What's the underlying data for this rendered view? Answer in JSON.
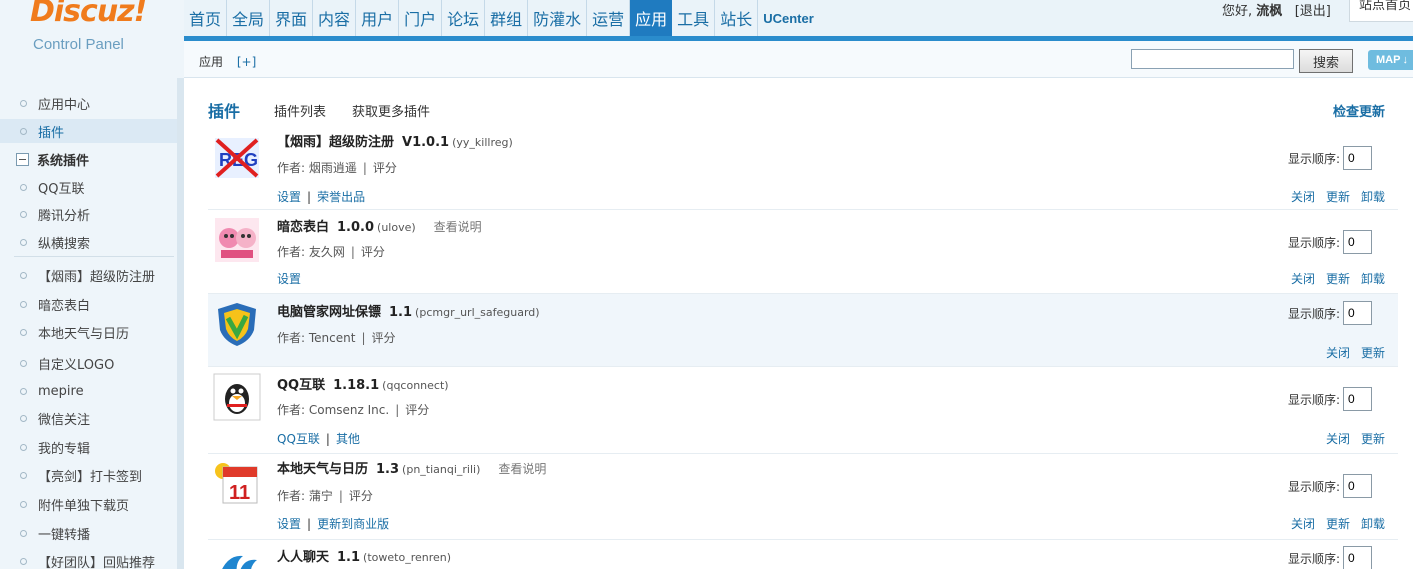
{
  "logo": {
    "main": "Discuz!",
    "sub": "Control Panel"
  },
  "topnav": [
    {
      "label": "首页"
    },
    {
      "label": "全局"
    },
    {
      "label": "界面"
    },
    {
      "label": "内容"
    },
    {
      "label": "用户"
    },
    {
      "label": "门户"
    },
    {
      "label": "论坛"
    },
    {
      "label": "群组"
    },
    {
      "label": "防灌水"
    },
    {
      "label": "运营"
    },
    {
      "label": "应用"
    },
    {
      "label": "工具"
    },
    {
      "label": "站长"
    },
    {
      "label": "UCenter"
    }
  ],
  "user": {
    "greeting": "您好,",
    "name": "流枫",
    "logout": "[退出]",
    "site_home": "站点首页"
  },
  "subbar": {
    "crumb": "应用",
    "plus": "[+]",
    "search_value": "",
    "search_button": "搜索",
    "map_label": "MAP"
  },
  "sidebar": {
    "items": [
      {
        "label": "应用中心"
      },
      {
        "label": "插件"
      },
      {
        "label": "系统插件"
      },
      {
        "label": "QQ互联"
      },
      {
        "label": "腾讯分析"
      },
      {
        "label": "纵横搜索"
      },
      {
        "label": "【烟雨】超级防注册"
      },
      {
        "label": "暗恋表白"
      },
      {
        "label": "本地天气与日历"
      },
      {
        "label": "自定义LOGO"
      },
      {
        "label": "mepire"
      },
      {
        "label": "微信关注"
      },
      {
        "label": "我的专辑"
      },
      {
        "label": "【亮剑】打卡签到"
      },
      {
        "label": "附件单独下载页"
      },
      {
        "label": "一键转播"
      },
      {
        "label": "【好团队】回贴推荐"
      }
    ]
  },
  "main": {
    "title": "插件",
    "tab_list": "插件列表",
    "tab_more": "获取更多插件",
    "check_update": "检查更新",
    "order_label": "显示顺序:",
    "plugins": [
      {
        "name": "【烟雨】超级防注册",
        "version": "V1.0.1",
        "ident": "(yy_killreg)",
        "readme": "",
        "author": "作者: 烟雨逍遥",
        "rate": "评分",
        "links": [
          "设置",
          "荣誉出品"
        ],
        "actions": [
          "关闭",
          "更新",
          "卸载"
        ],
        "order": "0"
      },
      {
        "name": "暗恋表白",
        "version": "1.0.0",
        "ident": "(ulove)",
        "readme": "查看说明",
        "author": "作者: 友久网",
        "rate": "评分",
        "links": [
          "设置"
        ],
        "actions": [
          "关闭",
          "更新",
          "卸载"
        ],
        "order": "0"
      },
      {
        "name": "电脑管家网址保镖",
        "version": "1.1",
        "ident": "(pcmgr_url_safeguard)",
        "readme": "",
        "author": "作者: Tencent",
        "rate": "评分",
        "links": [],
        "actions": [
          "关闭",
          "更新"
        ],
        "order": "0"
      },
      {
        "name": "QQ互联",
        "version": "1.18.1",
        "ident": "(qqconnect)",
        "readme": "",
        "author": "作者: Comsenz Inc.",
        "rate": "评分",
        "links": [
          "QQ互联",
          "其他"
        ],
        "actions": [
          "关闭",
          "更新"
        ],
        "order": "0"
      },
      {
        "name": "本地天气与日历",
        "version": "1.3",
        "ident": "(pn_tianqi_rili)",
        "readme": "查看说明",
        "author": "作者: 蒲宁",
        "rate": "评分",
        "links": [
          "设置",
          "更新到商业版"
        ],
        "actions": [
          "关闭",
          "更新",
          "卸载"
        ],
        "order": "0"
      },
      {
        "name": "人人聊天",
        "version": "1.1",
        "ident": "(toweto_renren)",
        "readme": "",
        "author": "",
        "rate": "",
        "links": [],
        "actions": [],
        "order": "0"
      }
    ]
  },
  "colors": {
    "accent": "#1f7bc0",
    "link": "#1a6ea5",
    "logo": "#f07b1c"
  }
}
